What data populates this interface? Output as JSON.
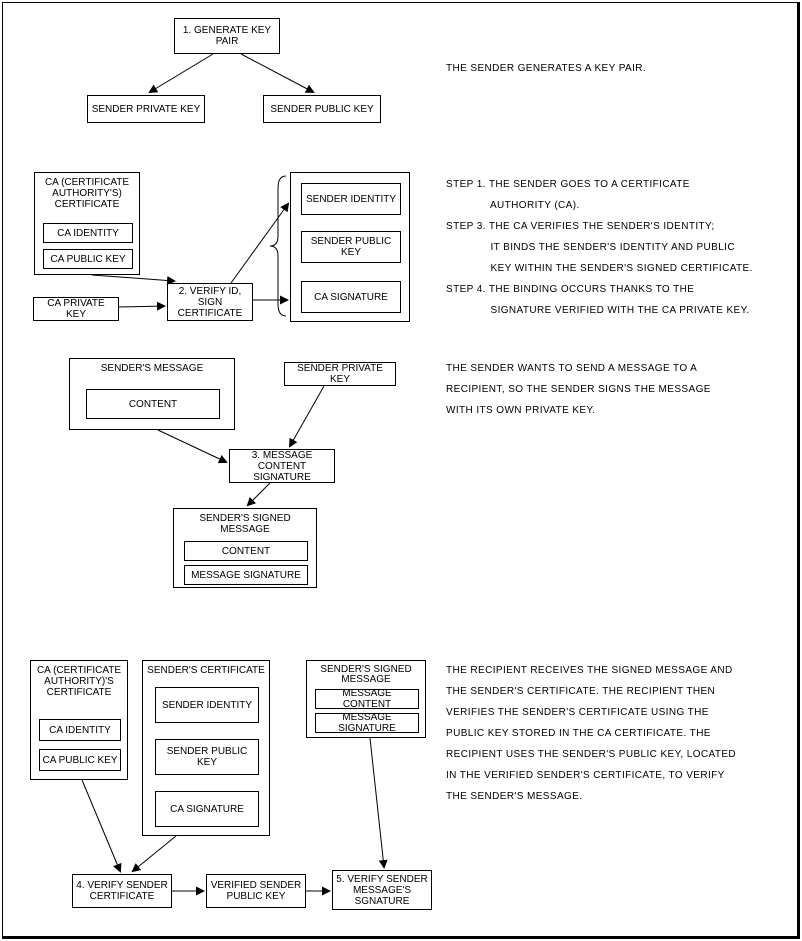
{
  "section1": {
    "generate": "1. GENERATE KEY PAIR",
    "priv": "SENDER PRIVATE KEY",
    "pub": "SENDER PUBLIC KEY",
    "desc": "THE SENDER GENERATES A KEY PAIR."
  },
  "section2": {
    "caCert": "CA (CERTIFICATE AUTHORITY'S) CERTIFICATE",
    "caId": "CA IDENTITY",
    "caPub": "CA PUBLIC KEY",
    "caPriv": "CA PRIVATE KEY",
    "verify": "2. VERIFY ID, SIGN CERTIFICATE",
    "senderId": "SENDER IDENTITY",
    "senderPub": "SENDER PUBLIC KEY",
    "caSig": "CA SIGNATURE",
    "desc": "STEP 1. THE SENDER GOES TO A CERTIFICATE\n              AUTHORITY (CA).\nSTEP 3. THE CA VERIFIES THE SENDER'S IDENTITY;\n              IT BINDS THE SENDER'S IDENTITY AND PUBLIC\n              KEY WITHIN THE SENDER'S SIGNED CERTIFICATE.\nSTEP 4. THE BINDING OCCURS THANKS TO THE\n              SIGNATURE VERIFIED WITH THE CA PRIVATE KEY."
  },
  "section3": {
    "msg": "SENDER'S MESSAGE",
    "content": "CONTENT",
    "priv": "SENDER PRIVATE KEY",
    "sig": "3. MESSAGE CONTENT SIGNATURE",
    "signed": "SENDER'S SIGNED MESSAGE",
    "content2": "CONTENT",
    "msgSig": "MESSAGE SIGNATURE",
    "desc": "THE SENDER WANTS TO SEND A MESSAGE TO A\nRECIPIENT, SO THE SENDER SIGNS THE MESSAGE\nWITH ITS OWN PRIVATE KEY."
  },
  "section4": {
    "caCert": "CA (CERTIFICATE AUTHORITY)'S CERTIFICATE",
    "caId": "CA IDENTITY",
    "caPub": "CA PUBLIC KEY",
    "senderCert": "SENDER'S CERTIFICATE",
    "senderId": "SENDER IDENTITY",
    "senderPub": "SENDER PUBLIC KEY",
    "caSig": "CA SIGNATURE",
    "signed": "SENDER'S SIGNED MESSAGE",
    "msgContent": "MESSAGE CONTENT",
    "msgSig": "MESSAGE SIGNATURE",
    "verifyCert": "4. VERIFY SENDER CERTIFICATE",
    "verifiedPub": "VERIFIED SENDER PUBLIC KEY",
    "verifySig": "5. VERIFY SENDER MESSAGE'S SGNATURE",
    "desc": "THE RECIPIENT RECEIVES THE SIGNED MESSAGE AND\nTHE SENDER'S CERTIFICATE. THE RECIPIENT THEN\nVERIFIES THE SENDER'S CERTIFICATE USING THE\nPUBLIC KEY STORED IN THE CA CERTIFICATE. THE\nRECIPIENT USES THE SENDER'S PUBLIC KEY, LOCATED\nIN THE VERIFIED SENDER'S CERTIFICATE, TO VERIFY\nTHE SENDER'S MESSAGE."
  }
}
